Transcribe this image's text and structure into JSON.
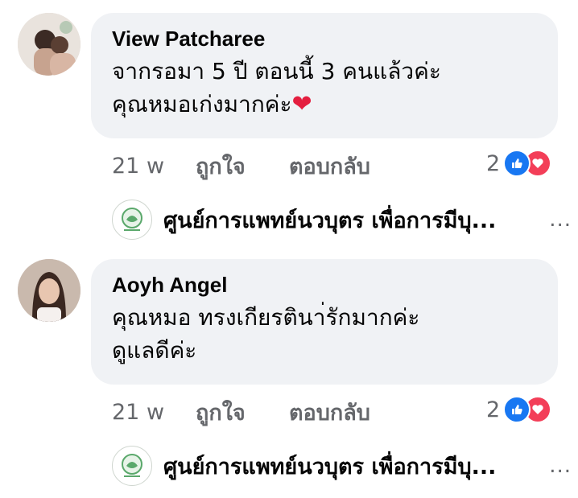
{
  "comments": [
    {
      "author": "View Patcharee",
      "lines": [
        "จากรอมา 5 ปี ตอนนี้ 3 คนแล้วค่ะ",
        "คุณหมอเก่งมากค่ะ"
      ],
      "emoji": "❤",
      "time": "21 w",
      "like_label": "ถูกใจ",
      "reply_label": "ตอบกลับ",
      "reaction_count": "2",
      "reaction_icons": [
        "like-icon",
        "love-icon"
      ],
      "reply_preview": {
        "author": "ศูนย์การแพทย์นวบุตร เพื่อการมีบุ...",
        "more": "..."
      }
    },
    {
      "author": "Aoyh Angel",
      "lines": [
        "คุณหมอ ทรงเกียรตินา่รักมากค่ะ",
        "ดูแลดีค่ะ"
      ],
      "time": "21 w",
      "like_label": "ถูกใจ",
      "reply_label": "ตอบกลับ",
      "reaction_count": "2",
      "reaction_icons": [
        "like-icon",
        "love-icon"
      ],
      "reply_preview": {
        "author": "ศูนย์การแพทย์นวบุตร เพื่อการมีบุ...",
        "more": "..."
      }
    }
  ],
  "colors": {
    "bubble": "#f0f2f5",
    "secondary_text": "#65676b",
    "like_blue": "#1877f2",
    "love_red": "#f33e58"
  }
}
